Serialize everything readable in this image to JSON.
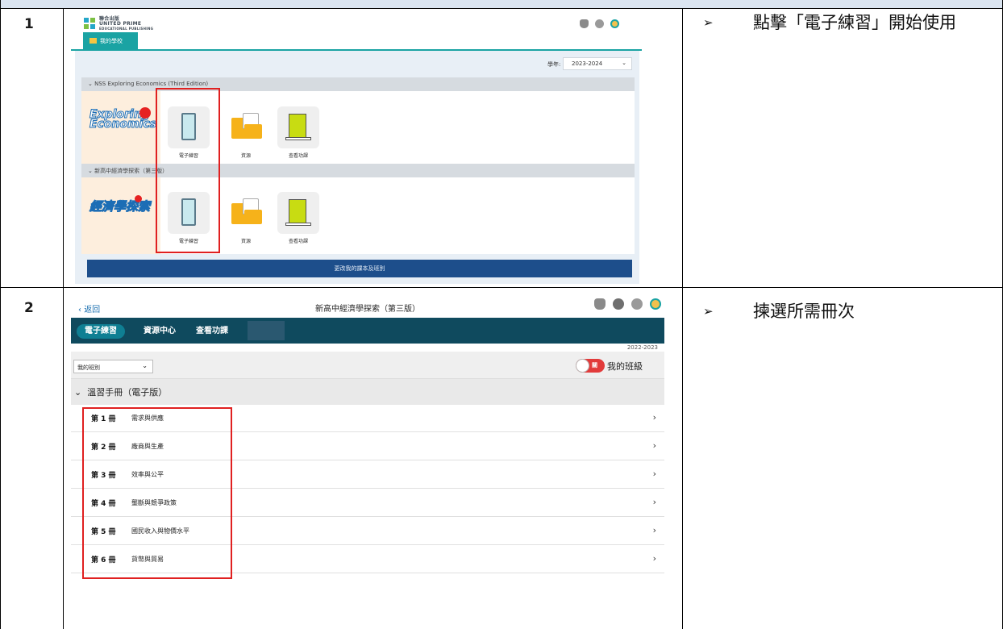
{
  "rows": [
    {
      "number": "1",
      "instruction_bullet": "➢",
      "instruction": "點擊「電子練習」開始使用"
    },
    {
      "number": "2",
      "instruction_bullet": "➢",
      "instruction": "揀選所需冊次"
    }
  ],
  "screen1": {
    "publisher_logo_lines": [
      "聯合出版",
      "UNITED PRIME",
      "EDUCATIONAL PUBLISHING"
    ],
    "tab_label": "我的學校",
    "year_label": "學年:",
    "year_value": "2023-2024",
    "books": [
      {
        "section_title": "NSS Exploring Economics (Third Edition)",
        "cover_text": "Exploring Economics",
        "tiles": [
          "電子練習",
          "資源",
          "查看功課"
        ]
      },
      {
        "section_title": "新高中經濟學探索（第三版）",
        "cover_text": "經濟學探索",
        "tiles": [
          "電子練習",
          "資源",
          "查看功課"
        ]
      }
    ],
    "change_button": "更改我的課本及班別",
    "colors": {
      "teal": "#1aa3a3",
      "panel": "#e8eff6",
      "button": "#1d4e8b",
      "highlight": "#e02020"
    }
  },
  "screen2": {
    "back_label": "返回",
    "title": "新高中經濟學探索（第三版）",
    "nav_tabs": [
      "電子練習",
      "資源中心",
      "查看功課"
    ],
    "active_tab": "電子練習",
    "year": "2022-2023",
    "class_select": "我的班別",
    "toggle_text": "關",
    "my_class_label": "我的班級",
    "section_title": "溫習手冊（電子版）",
    "volumes": [
      {
        "number": "第 1 冊",
        "title": "需求與供應"
      },
      {
        "number": "第 2 冊",
        "title": "廠商與生產"
      },
      {
        "number": "第 3 冊",
        "title": "效率與公平"
      },
      {
        "number": "第 4 冊",
        "title": "壟斷與競爭政策"
      },
      {
        "number": "第 5 冊",
        "title": "國民收入與物價水平"
      },
      {
        "number": "第 6 冊",
        "title": "貨幣與貿易"
      }
    ],
    "colors": {
      "navbar": "#0f4a5e",
      "active_tab": "#0f7f93",
      "toggle": "#e23b3b"
    }
  },
  "icons": [
    "bell-icon",
    "help-icon",
    "gear-icon",
    "avatar-icon",
    "chevron-down-icon",
    "chevron-right-icon",
    "tablet-icon",
    "resources-icon",
    "homework-icon"
  ]
}
